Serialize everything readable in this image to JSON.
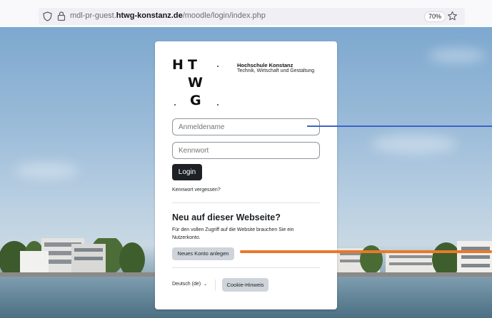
{
  "browser": {
    "url_prefix": "mdl-pr-guest.",
    "url_domain": "htwg-konstanz.de",
    "url_path": "/moodle/login/index.php",
    "zoom": "70%"
  },
  "logo": {
    "letter_h": "H",
    "letter_t": "T",
    "letter_w": "W",
    "letter_g": "G",
    "name": "Hochschule Konstanz",
    "subtitle": "Technik, Wirtschaft und Gestaltung"
  },
  "login": {
    "username_placeholder": "Anmeldename",
    "password_placeholder": "Kennwort",
    "login_label": "Login",
    "forgot_label": "Kennwort vergessen?"
  },
  "signup": {
    "heading": "Neu auf dieser Webseite?",
    "description": "Für den vollen Zugriff auf die Website brauchen Sie ein Nutzerkonto.",
    "create_label": "Neues Konto anlegen"
  },
  "footer": {
    "language_label": "Deutsch (de)",
    "cookie_label": "Cookie-Hinweis"
  },
  "colors": {
    "annotation_blue": "#3c63c7",
    "annotation_orange": "#e8792a",
    "button_dark": "#1d2125"
  }
}
